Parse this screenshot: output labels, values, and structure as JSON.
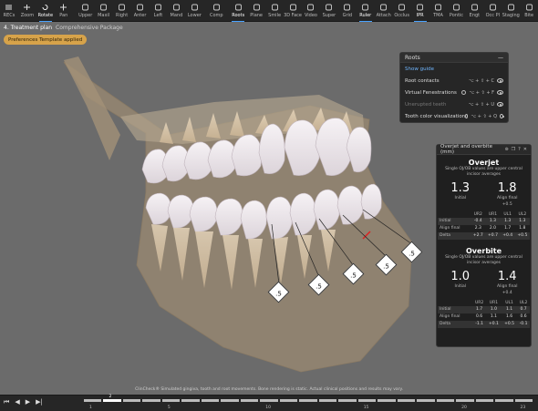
{
  "toolbar": {
    "tools": [
      {
        "label": "RECs",
        "icon": "menu-icon"
      },
      {
        "label": "Zoom",
        "icon": "zoom-icon"
      },
      {
        "label": "Rotate",
        "icon": "rotate-icon",
        "active": true
      },
      {
        "label": "Pan",
        "icon": "pan-icon"
      },
      {
        "label": "Upper",
        "icon": "upper-jaw-icon"
      },
      {
        "label": "Maxil",
        "icon": "maxilla-icon"
      },
      {
        "label": "Right",
        "icon": "right-view-icon"
      },
      {
        "label": "Anter",
        "icon": "anterior-view-icon"
      },
      {
        "label": "Left",
        "icon": "left-view-icon"
      },
      {
        "label": "Mand",
        "icon": "mandible-icon"
      },
      {
        "label": "Lower",
        "icon": "lower-jaw-icon"
      },
      {
        "label": "Comp",
        "icon": "compare-icon"
      },
      {
        "label": "Roots",
        "icon": "roots-icon",
        "active": true
      },
      {
        "label": "Plane",
        "icon": "plane-icon"
      },
      {
        "label": "Smile",
        "icon": "smile-icon"
      },
      {
        "label": "3D Face",
        "icon": "face-icon"
      },
      {
        "label": "Video",
        "icon": "video-icon"
      },
      {
        "label": "Super",
        "icon": "superimpose-icon"
      },
      {
        "label": "Grid",
        "icon": "grid-icon"
      },
      {
        "label": "Ruler",
        "icon": "ruler-icon",
        "active": true
      },
      {
        "label": "Attach",
        "icon": "attachment-icon"
      },
      {
        "label": "Occlus",
        "icon": "occlusion-icon"
      },
      {
        "label": "IPR",
        "icon": "ipr-icon",
        "active": true
      },
      {
        "label": "TMA",
        "icon": "tma-icon"
      },
      {
        "label": "Pontic",
        "icon": "pontic-icon"
      },
      {
        "label": "Engt",
        "icon": "engager-icon"
      },
      {
        "label": "Occ Pl",
        "icon": "occlusal-plane-icon"
      },
      {
        "label": "Staging",
        "icon": "staging-icon"
      },
      {
        "label": "Bite",
        "icon": "bite-icon"
      }
    ]
  },
  "header": {
    "title": "4. Treatment plan",
    "subtitle": "Comprehensive Package"
  },
  "badge": "Preferences Template applied",
  "ipr_labels": [
    ".5",
    ".5",
    ".5",
    ".5",
    ".5"
  ],
  "footer_note": "ClinCheck® Simulated gingiva, tooth and root movements. Bone rendering is static. Actual clinical positions and results may vary.",
  "roots_panel": {
    "title": "Roots",
    "show_guide": "Show guide",
    "rows": [
      {
        "label": "Root contacts",
        "shortcut": "⌥ + ⇧ + C"
      },
      {
        "label": "Virtual Fenestrations",
        "shortcut": "⌥ + ⇧ + F"
      },
      {
        "label": "Unerupted teeth",
        "shortcut": "⌥ + ⇧ + U"
      },
      {
        "label": "Tooth color visualization",
        "shortcut": "⌥ + ⇧ + Q"
      }
    ]
  },
  "overjet_panel": {
    "title": "Overjet and overbite (mm)",
    "overjet": {
      "title": "Overjet",
      "note": "Single OJ/OB values are upper central incisor averages",
      "initial": "1.3",
      "initial_label": "Initial",
      "final": "1.8",
      "final_label": "Align final",
      "final_delta": "+0.5",
      "headers": [
        "",
        "UR2",
        "UR1",
        "UL1",
        "UL2"
      ],
      "rows": [
        {
          "label": "Initial",
          "values": [
            "-0.4",
            "1.3",
            "1.3",
            "1.3"
          ]
        },
        {
          "label": "Align final",
          "values": [
            "2.3",
            "2.0",
            "1.7",
            "1.8"
          ]
        },
        {
          "label": "Delta",
          "values": [
            "+2.7",
            "+0.7",
            "+0.4",
            "+0.5"
          ]
        }
      ]
    },
    "overbite": {
      "title": "Overbite",
      "note": "Single OJ/OB values are upper central incisor averages",
      "initial": "1.0",
      "initial_label": "Initial",
      "final": "1.4",
      "final_label": "Align final",
      "final_delta": "+0.4",
      "headers": [
        "",
        "UR2",
        "UR1",
        "UL1",
        "UL2"
      ],
      "rows": [
        {
          "label": "Initial",
          "values": [
            "1.7",
            "1.0",
            "1.1",
            "0.7"
          ]
        },
        {
          "label": "Align final",
          "values": [
            "0.6",
            "1.1",
            "1.6",
            "0.6"
          ]
        },
        {
          "label": "Delta",
          "values": [
            "-1.1",
            "+0.1",
            "+0.5",
            "-0.1"
          ]
        }
      ]
    }
  },
  "timeline": {
    "ticks": [
      "1",
      "5",
      "10",
      "15",
      "20",
      "23"
    ],
    "current_stage": "2"
  }
}
